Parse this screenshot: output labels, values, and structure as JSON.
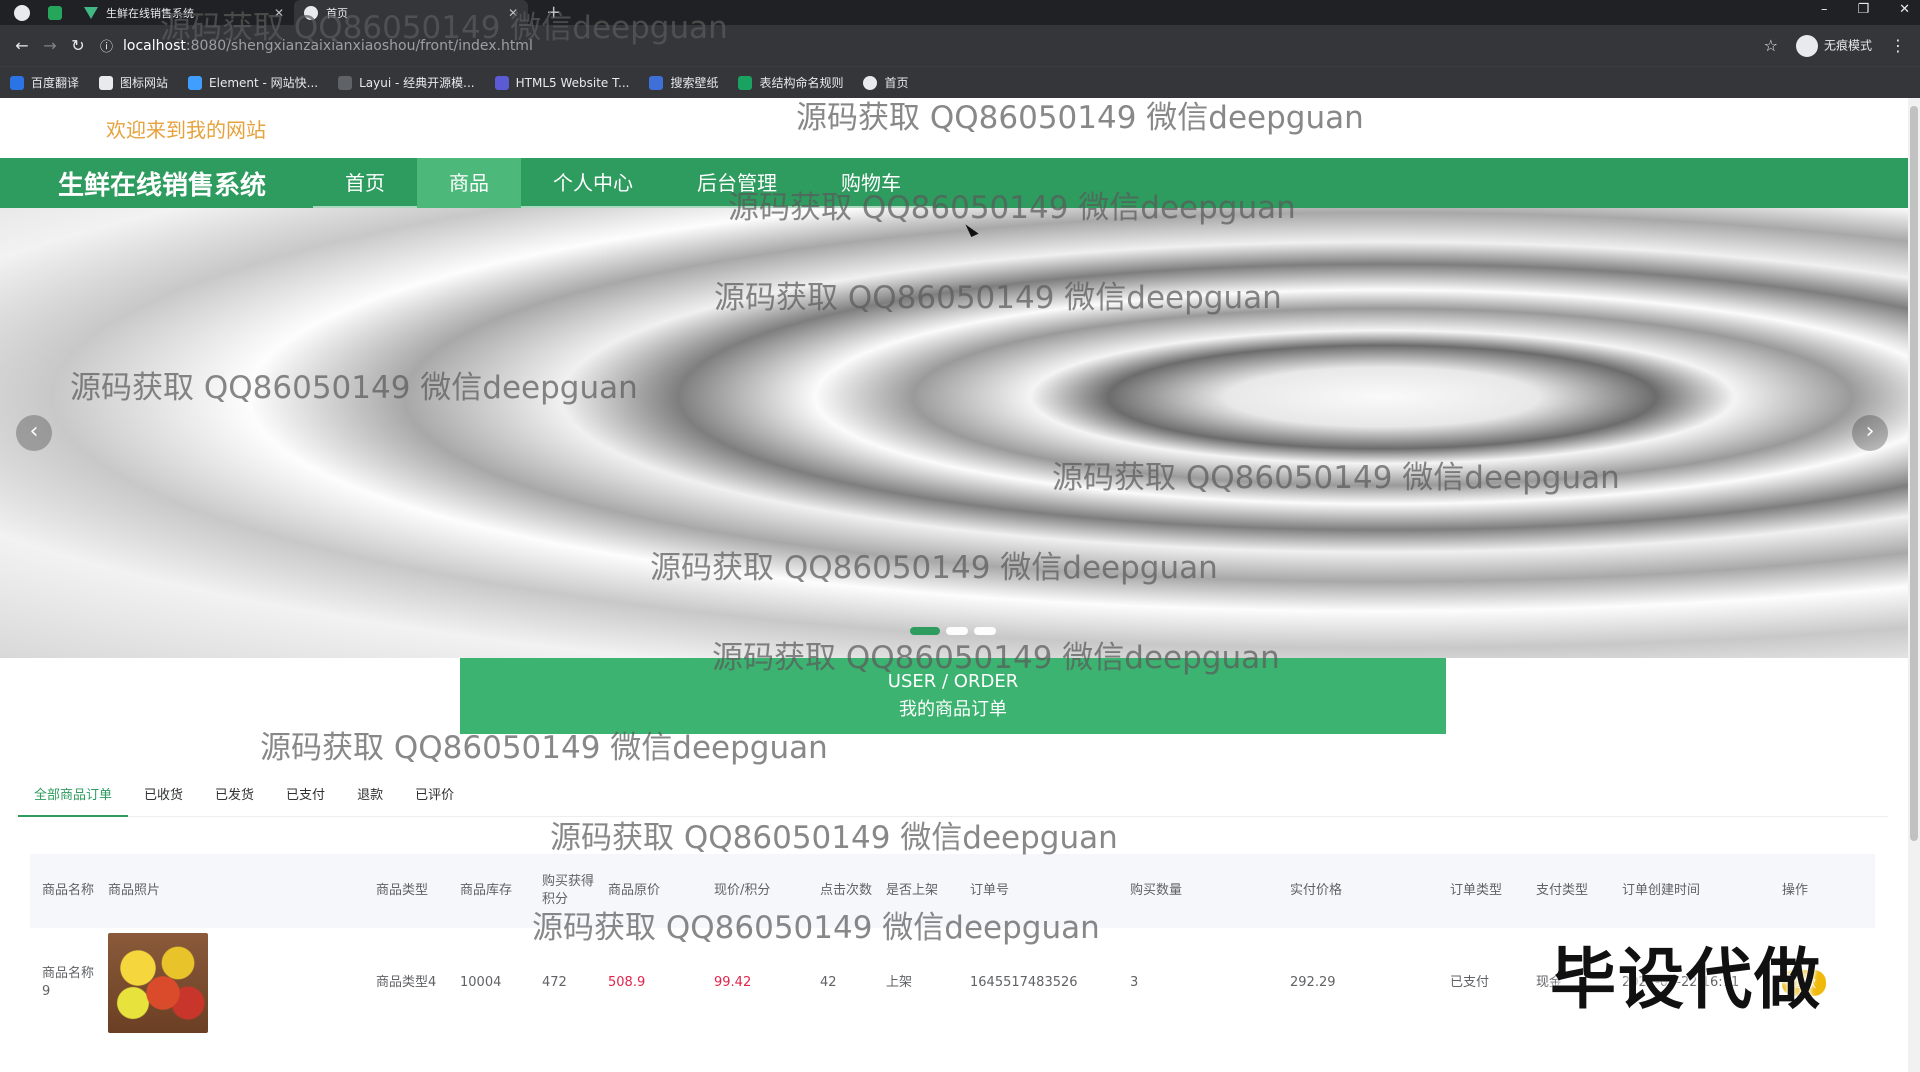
{
  "browser": {
    "tabs": [
      {
        "title": "生鲜在线销售系统"
      },
      {
        "title": "首页"
      }
    ],
    "url_host": "localhost",
    "url_path": ":8080/shengxianzaixianxiaoshou/front/index.html",
    "incognito_label": "无痕模式",
    "bookmarks": [
      "百度翻译",
      "图标网站",
      "Element - 网站快...",
      "Layui - 经典开源模...",
      "HTML5 Website T...",
      "搜索壁纸",
      "表结构命名规则",
      "首页"
    ]
  },
  "header": {
    "welcome": "欢迎来到我的网站",
    "site_title": "生鲜在线销售系统",
    "nav": [
      "首页",
      "商品",
      "个人中心",
      "后台管理",
      "购物车"
    ],
    "active_nav": "商品"
  },
  "carousel": {
    "prev_icon": "chevron-left-icon",
    "next_icon": "chevron-right-icon",
    "slide_count": 3,
    "active_index": 0
  },
  "order_section": {
    "title_en": "USER / ORDER",
    "title_cn": "我的商品订单"
  },
  "order_tabs": [
    "全部商品订单",
    "已收货",
    "已发货",
    "已支付",
    "退款",
    "已评价"
  ],
  "table": {
    "headers": [
      "商品名称",
      "商品照片",
      "商品类型",
      "商品库存",
      "购买获得积分",
      "商品原价",
      "现价/积分",
      "点击次数",
      "是否上架",
      "订单号",
      "购买数量",
      "实付价格",
      "订单类型",
      "支付类型",
      "订单创建时间",
      "操作"
    ],
    "rows": [
      {
        "name": "商品名称9",
        "type": "商品类型4",
        "stock": "10004",
        "points": "472",
        "original_price": "508.9",
        "price": "99.42",
        "clicks": "42",
        "on_sale": "上架",
        "order_no": "1645517483526",
        "quantity": "3",
        "paid": "292.29",
        "order_type": "已支付",
        "pay_type": "现金",
        "created": "2022-02-22 16:11",
        "action": "退款"
      }
    ]
  },
  "watermark": "源码获取 QQ86050149 微信deepguan",
  "stamp": "毕设代做",
  "colors": {
    "brand_green": "#2e9b5f",
    "accent_orange": "#e6a23c",
    "price_red": "#e0244a"
  }
}
